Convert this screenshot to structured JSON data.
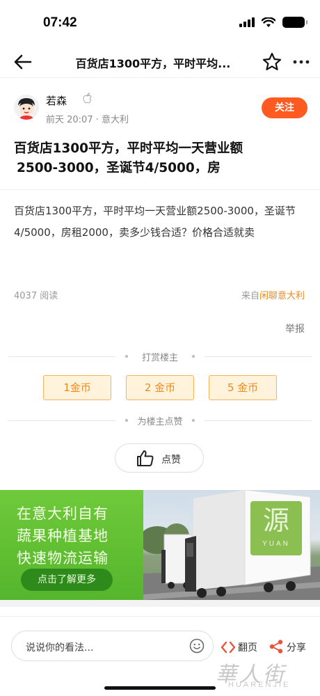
{
  "status_bar": {
    "time": "07:42"
  },
  "nav": {
    "title": "百货店1300平方，平时平均..."
  },
  "author": {
    "name": "若森",
    "meta": "前天 20:07 · 意大利",
    "follow_label": "关注"
  },
  "post": {
    "title_line1": "百货店1300平方，平时平均一天营业额",
    "title_line2": "2500-3000，圣诞节4/5000，房",
    "body": "百货店1300平方，平时平均一天营业额2500-3000，圣诞节4/5000，房租2000，卖多少钱合适？价格合适就卖",
    "read_count": "4037 阅读",
    "source_prefix": "来自",
    "source_link": "闲聊意大利",
    "report_label": "举报"
  },
  "reward": {
    "section_label": "打赏楼主",
    "coins": [
      "1金币",
      "2 金币",
      "5 金币"
    ]
  },
  "like": {
    "section_label": "为楼主点赞",
    "button_label": "点赞"
  },
  "ad": {
    "lines": [
      "在意大利自有",
      "蔬果种植基地",
      "快速物流运输"
    ],
    "cta": "点击了解更多",
    "logo_text": "YUAN",
    "logo_char": "源"
  },
  "bottom_bar": {
    "comment_placeholder": "说说你的看法...",
    "page_label": "翻页",
    "share_label": "分享"
  },
  "watermark": {
    "cn": "華人街",
    "en": "HUARENJIE"
  },
  "colors": {
    "accent": "#ff5a1f",
    "coin": "#f08a1c",
    "ad_green": "#55b52c"
  }
}
